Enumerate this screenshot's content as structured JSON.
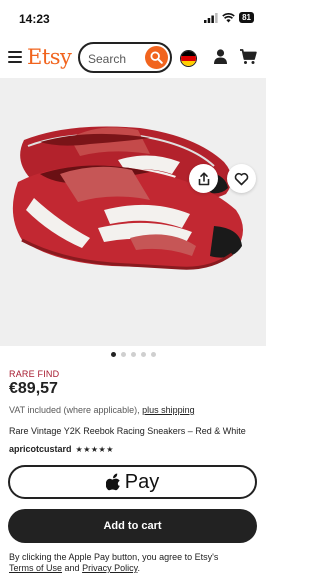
{
  "status_bar": {
    "time": "14:23",
    "battery": "81",
    "icons": [
      "signal-icon",
      "wifi-icon",
      "battery-icon"
    ]
  },
  "header": {
    "logo": "Etsy",
    "search_placeholder": "Search",
    "icons": [
      "menu-icon",
      "search-icon",
      "country-flag-icon",
      "user-icon",
      "cart-icon"
    ],
    "brand_color": "#f1641e"
  },
  "gallery": {
    "image_description": "red leather sneakers",
    "image_count": 5,
    "active_index": 0,
    "icons": [
      "share-icon",
      "heart-icon"
    ]
  },
  "listing": {
    "badge": "RARE FIND",
    "badge_color": "#a61a2e",
    "price": "€89,57",
    "vat_text": "VAT included (where applicable),",
    "shipping_link": "plus shipping",
    "title": "Rare Vintage Y2K Reebok Racing Sneakers – Red & White",
    "shop_name": "apricotcustard",
    "rating_stars": "★★★★★",
    "rating": 5
  },
  "actions": {
    "apple_pay_label": "Pay",
    "add_to_cart_label": "Add to cart"
  },
  "disclaimer": {
    "prefix": "By clicking the Apple Pay button, you agree to Etsy's",
    "terms_link": "Terms of Use",
    "joiner": "and",
    "privacy_link": "Privacy Policy",
    "suffix": "."
  }
}
